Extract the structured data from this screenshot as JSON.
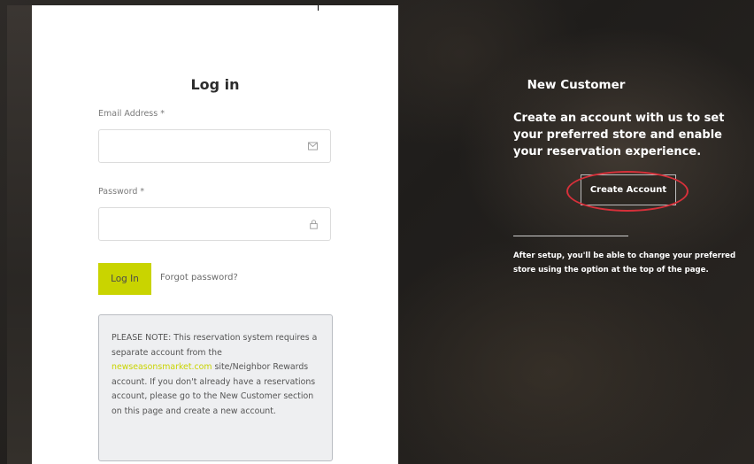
{
  "login": {
    "title": "Log in",
    "email_label": "Email Address *",
    "email_value": "",
    "email_icon": "envelope-icon",
    "password_label": "Password *",
    "password_value": "",
    "password_icon": "lock-icon",
    "login_button": "Log In",
    "forgot_link": "Forgot password?"
  },
  "note": {
    "prefix": "PLEASE NOTE: This reservation system requires a separate account from the ",
    "link": "newseasonsmarket.com",
    "suffix": " site/Neighbor Rewards account. If you don't already have a reservations account, please go to the New Customer section on this page and create a new account."
  },
  "new_customer": {
    "title": "New Customer",
    "description": "Create an account with us to set your preferred store and enable your reservation experience.",
    "create_button": "Create Account",
    "after_text": "After setup, you'll be able to change your preferred store using the option at the top of the page."
  },
  "colors": {
    "accent": "#c9d400",
    "highlight_circle": "#d6303a",
    "dark_panel": "#252220"
  }
}
